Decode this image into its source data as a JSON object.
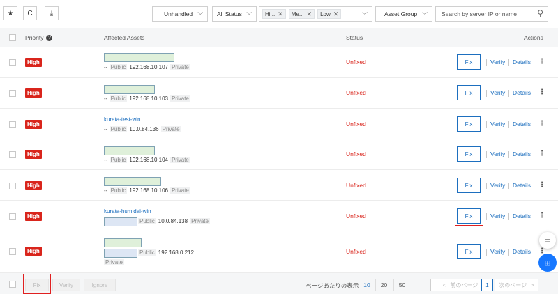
{
  "toolbar": {
    "star_icon": "★",
    "refresh_icon": "C",
    "download_icon": "⤓",
    "filter_handled": "Unhandled",
    "filter_status": "All Status",
    "priority_tags": [
      "Hi...",
      "Me...",
      "Low"
    ],
    "asset_group": "Asset Group",
    "search_placeholder": "Search by server IP or name"
  },
  "table": {
    "headers": {
      "priority": "Priority",
      "affected_assets": "Affected Assets",
      "status": "Status",
      "actions": "Actions"
    },
    "rows": [
      {
        "priority": "High",
        "name": "",
        "prefix": "--",
        "public_label": "Public",
        "ip": "192.168.10.107",
        "private_label": "Private",
        "status": "Unfixed"
      },
      {
        "priority": "High",
        "name": "",
        "prefix": "--",
        "public_label": "Public",
        "ip": "192.168.10.103",
        "private_label": "Private",
        "status": "Unfixed"
      },
      {
        "priority": "High",
        "name": "kurata-test-win",
        "prefix": "--",
        "public_label": "Public",
        "ip": "10.0.84.136",
        "private_label": "Private",
        "status": "Unfixed"
      },
      {
        "priority": "High",
        "name": "",
        "prefix": "--",
        "public_label": "Public",
        "ip": "192.168.10.104",
        "private_label": "Private",
        "status": "Unfixed"
      },
      {
        "priority": "High",
        "name": "",
        "prefix": "--",
        "public_label": "Public",
        "ip": "192.168.10.106",
        "private_label": "Private",
        "status": "Unfixed"
      },
      {
        "priority": "High",
        "name": "kurata-humidai-win",
        "prefix": "",
        "public_label": "Public",
        "ip": "10.0.84.138",
        "private_label": "Private",
        "status": "Unfixed"
      },
      {
        "priority": "High",
        "name": "",
        "prefix": "",
        "public_label": "Public",
        "ip": "192.168.0.212",
        "private_label": "Private",
        "status": "Unfixed"
      }
    ],
    "actions": {
      "fix": "Fix",
      "verify": "Verify",
      "details": "Details",
      "more": "⋮"
    }
  },
  "footer": {
    "fix": "Fix",
    "verify": "Verify",
    "ignore": "Ignore",
    "per_page_label": "ページあたりの表示",
    "page_sizes": [
      "10",
      "20",
      "50"
    ],
    "prev": "前のページ",
    "current_page": "1",
    "next": "次のページ"
  },
  "colors": {
    "accent": "#1d6fbf",
    "danger": "#d9251c",
    "highlight": "#e02020",
    "fab": "#1677ff"
  }
}
